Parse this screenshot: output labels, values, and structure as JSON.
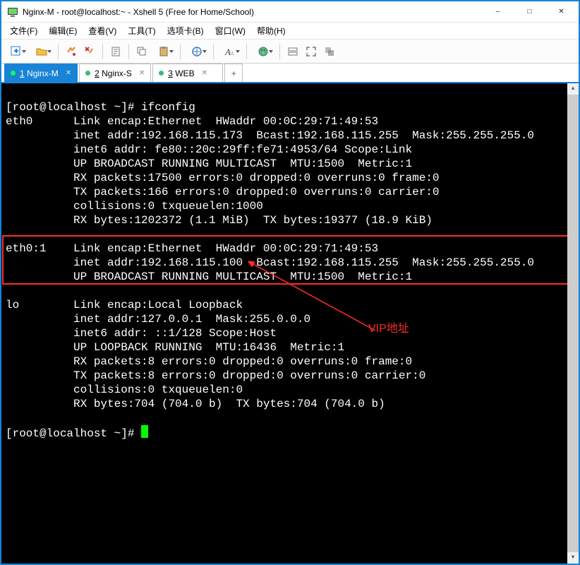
{
  "window": {
    "title": "Nginx-M - root@localhost:~ - Xshell 5 (Free for Home/School)"
  },
  "menu": {
    "file": "文件(F)",
    "edit": "编辑(E)",
    "view": "查看(V)",
    "tools": "工具(T)",
    "tabs": "选项卡(B)",
    "window": "窗口(W)",
    "help": "帮助(H)"
  },
  "tabs": [
    {
      "num": "1",
      "label": "Nginx-M",
      "active": true
    },
    {
      "num": "2",
      "label": "Nginx-S",
      "active": false
    },
    {
      "num": "3",
      "label": "WEB",
      "active": false
    }
  ],
  "annotation": {
    "vip_label": "VIP地址"
  },
  "terminal": {
    "prompt1": "[root@localhost ~]# ifconfig",
    "prompt2": "[root@localhost ~]# ",
    "eth0": {
      "l1": "eth0      Link encap:Ethernet  HWaddr 00:0C:29:71:49:53",
      "l2": "          inet addr:192.168.115.173  Bcast:192.168.115.255  Mask:255.255.255.0",
      "l3": "          inet6 addr: fe80::20c:29ff:fe71:4953/64 Scope:Link",
      "l4": "          UP BROADCAST RUNNING MULTICAST  MTU:1500  Metric:1",
      "l5": "          RX packets:17500 errors:0 dropped:0 overruns:0 frame:0",
      "l6": "          TX packets:166 errors:0 dropped:0 overruns:0 carrier:0",
      "l7": "          collisions:0 txqueuelen:1000",
      "l8": "          RX bytes:1202372 (1.1 MiB)  TX bytes:19377 (18.9 KiB)"
    },
    "eth0_1": {
      "l1": "eth0:1    Link encap:Ethernet  HWaddr 00:0C:29:71:49:53",
      "l2": "          inet addr:192.168.115.100  Bcast:192.168.115.255  Mask:255.255.255.0",
      "l3": "          UP BROADCAST RUNNING MULTICAST  MTU:1500  Metric:1"
    },
    "lo": {
      "l1": "lo        Link encap:Local Loopback",
      "l2": "          inet addr:127.0.0.1  Mask:255.0.0.0",
      "l3": "          inet6 addr: ::1/128 Scope:Host",
      "l4": "          UP LOOPBACK RUNNING  MTU:16436  Metric:1",
      "l5": "          RX packets:8 errors:0 dropped:0 overruns:0 frame:0",
      "l6": "          TX packets:8 errors:0 dropped:0 overruns:0 carrier:0",
      "l7": "          collisions:0 txqueuelen:0",
      "l8": "          RX bytes:704 (704.0 b)  TX bytes:704 (704.0 b)"
    }
  }
}
